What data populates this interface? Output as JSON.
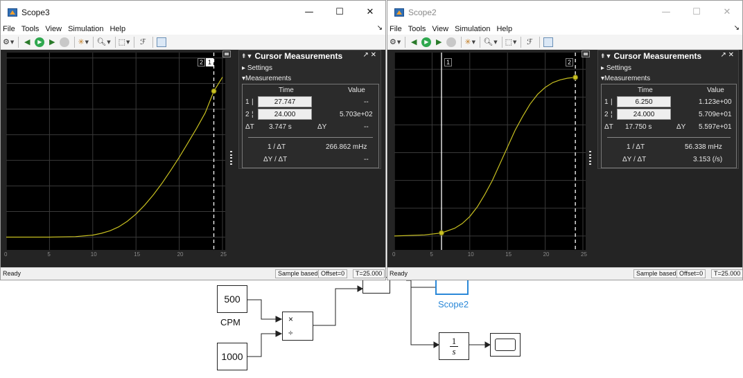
{
  "diagram": {
    "constant_a": {
      "value": "500",
      "label": "CPM"
    },
    "constant_b": {
      "value": "1000",
      "label": "1000"
    },
    "product": {
      "multiply": "×",
      "divide": "÷"
    },
    "scope2_label": "Scope2",
    "integrator": {
      "numerator": "1",
      "denominator": "s"
    }
  },
  "scope3": {
    "title": "Scope3",
    "window_buttons": {
      "minimize": "—",
      "maximize": "☐",
      "close": "✕"
    },
    "menu": [
      "File",
      "Tools",
      "View",
      "Simulation",
      "Help"
    ],
    "menu_underline": [
      "F",
      "T",
      "V",
      "m",
      "H"
    ],
    "plot": {
      "y_ticks": [
        "700",
        "600",
        "500",
        "400",
        "300",
        "200",
        "100",
        "0"
      ],
      "x_ticks": [
        "0",
        "5",
        "10",
        "15",
        "20",
        "25"
      ],
      "cursor_tags": [
        "2",
        "1"
      ]
    },
    "measurements": {
      "title": "Cursor Measurements",
      "settings": "Settings",
      "measurements": "Measurements",
      "col_time": "Time",
      "col_value": "Value",
      "rows": [
        {
          "idx": "1",
          "time": "27.747",
          "value": "--"
        },
        {
          "idx": "2",
          "time": "24.000",
          "value": "5.703e+02"
        }
      ],
      "dt_label": "ΔT",
      "dt_value": "3.747 s",
      "dy_label": "ΔY",
      "dy_value": "--",
      "inv_dt_label": "1 / ΔT",
      "inv_dt_value": "266.862 mHz",
      "dydt_label": "ΔY / ΔT",
      "dydt_value": "--"
    },
    "status": {
      "ready": "Ready",
      "sample": "Sample based",
      "offset": "Offset=0",
      "time": "T=25.000"
    }
  },
  "scope2": {
    "title": "Scope2",
    "window_buttons": {
      "minimize": "—",
      "maximize": "☐",
      "close": "✕"
    },
    "menu": [
      "File",
      "Tools",
      "View",
      "Simulation",
      "Help"
    ],
    "menu_underline": [
      "F",
      "T",
      "V",
      "m",
      "H"
    ],
    "plot": {
      "y_ticks": [
        "60",
        "50",
        "40",
        "30",
        "20",
        "10",
        "0"
      ],
      "x_ticks": [
        "0",
        "5",
        "10",
        "15",
        "20",
        "25"
      ],
      "cursor_tags": [
        "1",
        "2"
      ]
    },
    "measurements": {
      "title": "Cursor Measurements",
      "settings": "Settings",
      "measurements": "Measurements",
      "col_time": "Time",
      "col_value": "Value",
      "rows": [
        {
          "idx": "1",
          "time": "6.250",
          "value": "1.123e+00"
        },
        {
          "idx": "2",
          "time": "24.000",
          "value": "5.709e+01"
        }
      ],
      "dt_label": "ΔT",
      "dt_value": "17.750 s",
      "dy_label": "ΔY",
      "dy_value": "5.597e+01",
      "inv_dt_label": "1 / ΔT",
      "inv_dt_value": "56.338 mHz",
      "dydt_label": "ΔY / ΔT",
      "dydt_value": "3.153 (/s)"
    },
    "status": {
      "ready": "Ready",
      "sample": "Sample based",
      "offset": "Offset=0",
      "time": "T=25.000"
    }
  },
  "chart_data": [
    {
      "type": "line",
      "title": "",
      "xlabel": "",
      "ylabel": "",
      "xlim": [
        0,
        25
      ],
      "ylim": [
        -50,
        710
      ],
      "x_ticks": [
        0,
        5,
        10,
        15,
        20,
        25
      ],
      "y_ticks": [
        0,
        100,
        200,
        300,
        400,
        500,
        600,
        700
      ],
      "grid": true,
      "line_color": "#c8c020",
      "series": [
        {
          "x": [
            0,
            5,
            8,
            10,
            11,
            12,
            13,
            14,
            15,
            16,
            17,
            18,
            19,
            20,
            21,
            22,
            23,
            24,
            25
          ],
          "y": [
            0,
            0,
            2,
            8,
            15,
            25,
            40,
            62,
            90,
            125,
            165,
            210,
            260,
            312,
            368,
            425,
            485,
            570,
            625
          ]
        }
      ],
      "cursors": [
        {
          "x": 24.0,
          "y": 570.3
        }
      ]
    },
    {
      "type": "line",
      "title": "",
      "xlabel": "",
      "ylabel": "",
      "xlim": [
        0,
        25
      ],
      "ylim": [
        -5,
        65
      ],
      "x_ticks": [
        0,
        5,
        10,
        15,
        20,
        25
      ],
      "y_ticks": [
        0,
        10,
        20,
        30,
        40,
        50,
        60
      ],
      "grid": true,
      "line_color": "#c8c020",
      "series": [
        {
          "x": [
            0,
            4,
            6.25,
            8,
            9,
            10,
            11,
            12,
            13,
            14,
            15,
            16,
            17,
            18,
            19,
            20,
            21,
            22,
            23,
            24
          ],
          "y": [
            0,
            0.4,
            1.1,
            2.8,
            4.5,
            7,
            10.5,
            15,
            20,
            26,
            32,
            38,
            43,
            47.5,
            51,
            53.5,
            55.2,
            56.2,
            56.8,
            57.1
          ]
        }
      ],
      "cursors": [
        {
          "x": 6.25,
          "y": 1.123
        },
        {
          "x": 24.0,
          "y": 57.09
        }
      ]
    }
  ]
}
